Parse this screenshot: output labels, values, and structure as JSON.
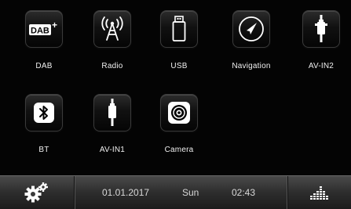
{
  "apps": {
    "dab": {
      "label": "DAB",
      "logo_text": "DAB",
      "logo_plus": "+"
    },
    "radio": {
      "label": "Radio"
    },
    "usb": {
      "label": "USB"
    },
    "navigation": {
      "label": "Navigation"
    },
    "avin2": {
      "label": "AV-IN2"
    },
    "bt": {
      "label": "BT"
    },
    "avin1": {
      "label": "AV-IN1"
    },
    "camera": {
      "label": "Camera"
    }
  },
  "status_bar": {
    "date": "01.01.2017",
    "day": "Sun",
    "time": "02:43",
    "settings_icon": "gear-icon",
    "equalizer_icon": "equalizer-icon"
  }
}
